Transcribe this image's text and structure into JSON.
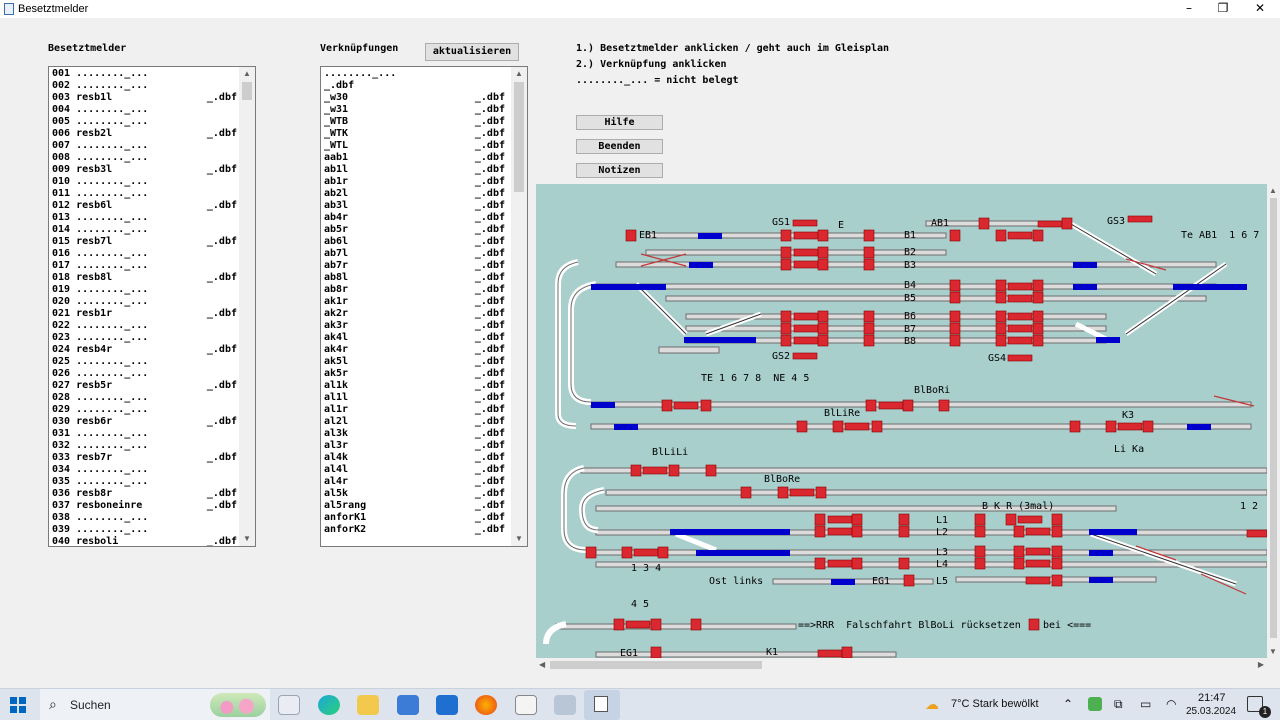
{
  "window": {
    "title": "Besetztmelder",
    "minimize": "–",
    "maximize": "❐",
    "close": "✕"
  },
  "left_panel": {
    "header": "Besetztmelder",
    "rows": [
      {
        "t": "001 ........_...",
        "e": ""
      },
      {
        "t": "002 ........_...",
        "e": ""
      },
      {
        "t": "003 resb1l",
        "e": "_.dbf"
      },
      {
        "t": "004 ........_...",
        "e": ""
      },
      {
        "t": "005 ........_...",
        "e": ""
      },
      {
        "t": "006 resb2l",
        "e": "_.dbf"
      },
      {
        "t": "007 ........_...",
        "e": ""
      },
      {
        "t": "008 ........_...",
        "e": ""
      },
      {
        "t": "009 resb3l",
        "e": "_.dbf"
      },
      {
        "t": "010 ........_...",
        "e": ""
      },
      {
        "t": "011 ........_...",
        "e": ""
      },
      {
        "t": "012 resb6l",
        "e": "_.dbf"
      },
      {
        "t": "013 ........_...",
        "e": ""
      },
      {
        "t": "014 ........_...",
        "e": ""
      },
      {
        "t": "015 resb7l",
        "e": "_.dbf"
      },
      {
        "t": "016 ........_...",
        "e": ""
      },
      {
        "t": "017 ........_...",
        "e": ""
      },
      {
        "t": "018 resb8l",
        "e": "_.dbf"
      },
      {
        "t": "019 ........_...",
        "e": ""
      },
      {
        "t": "020 ........_...",
        "e": ""
      },
      {
        "t": "021 resb1r",
        "e": "_.dbf"
      },
      {
        "t": "022 ........_...",
        "e": ""
      },
      {
        "t": "023 ........_...",
        "e": ""
      },
      {
        "t": "024 resb4r",
        "e": "_.dbf"
      },
      {
        "t": "025 ........_...",
        "e": ""
      },
      {
        "t": "026 ........_...",
        "e": ""
      },
      {
        "t": "027 resb5r",
        "e": "_.dbf"
      },
      {
        "t": "028 ........_...",
        "e": ""
      },
      {
        "t": "029 ........_...",
        "e": ""
      },
      {
        "t": "030 resb6r",
        "e": "_.dbf"
      },
      {
        "t": "031 ........_...",
        "e": ""
      },
      {
        "t": "032 ........_...",
        "e": ""
      },
      {
        "t": "033 resb7r",
        "e": "_.dbf"
      },
      {
        "t": "034 ........_...",
        "e": ""
      },
      {
        "t": "035 ........_...",
        "e": ""
      },
      {
        "t": "036 resb8r",
        "e": "_.dbf"
      },
      {
        "t": "037 resboneinre",
        "e": "_.dbf"
      },
      {
        "t": "038 ........_...",
        "e": ""
      },
      {
        "t": "039 ........_...",
        "e": ""
      },
      {
        "t": "040 resboli",
        "e": "_.dbf"
      }
    ]
  },
  "middle_panel": {
    "header": "Verknüpfungen",
    "refresh_button": "aktualisieren",
    "rows": [
      {
        "t": "........_...",
        "e": ""
      },
      {
        "t": "_.dbf",
        "e": ""
      },
      {
        "t": "_w30",
        "e": "_.dbf"
      },
      {
        "t": "_w31",
        "e": "_.dbf"
      },
      {
        "t": "_WTB",
        "e": "_.dbf"
      },
      {
        "t": "_WTK",
        "e": "_.dbf"
      },
      {
        "t": "_WTL",
        "e": "_.dbf"
      },
      {
        "t": "aab1",
        "e": "_.dbf"
      },
      {
        "t": "ab1l",
        "e": "_.dbf"
      },
      {
        "t": "ab1r",
        "e": "_.dbf"
      },
      {
        "t": "ab2l",
        "e": "_.dbf"
      },
      {
        "t": "ab3l",
        "e": "_.dbf"
      },
      {
        "t": "ab4r",
        "e": "_.dbf"
      },
      {
        "t": "ab5r",
        "e": "_.dbf"
      },
      {
        "t": "ab6l",
        "e": "_.dbf"
      },
      {
        "t": "ab7l",
        "e": "_.dbf"
      },
      {
        "t": "ab7r",
        "e": "_.dbf"
      },
      {
        "t": "ab8l",
        "e": "_.dbf"
      },
      {
        "t": "ab8r",
        "e": "_.dbf"
      },
      {
        "t": "ak1r",
        "e": "_.dbf"
      },
      {
        "t": "ak2r",
        "e": "_.dbf"
      },
      {
        "t": "ak3r",
        "e": "_.dbf"
      },
      {
        "t": "ak4l",
        "e": "_.dbf"
      },
      {
        "t": "ak4r",
        "e": "_.dbf"
      },
      {
        "t": "ak5l",
        "e": "_.dbf"
      },
      {
        "t": "ak5r",
        "e": "_.dbf"
      },
      {
        "t": "al1k",
        "e": "_.dbf"
      },
      {
        "t": "al1l",
        "e": "_.dbf"
      },
      {
        "t": "al1r",
        "e": "_.dbf"
      },
      {
        "t": "al2l",
        "e": "_.dbf"
      },
      {
        "t": "al3k",
        "e": "_.dbf"
      },
      {
        "t": "al3r",
        "e": "_.dbf"
      },
      {
        "t": "al4k",
        "e": "_.dbf"
      },
      {
        "t": "al4l",
        "e": "_.dbf"
      },
      {
        "t": "al4r",
        "e": "_.dbf"
      },
      {
        "t": "al5k",
        "e": "_.dbf"
      },
      {
        "t": "al5rang",
        "e": "_.dbf"
      },
      {
        "t": "anforK1",
        "e": "_.dbf"
      },
      {
        "t": "anforK2",
        "e": "_.dbf"
      }
    ]
  },
  "instructions": [
    "1.) Besetztmelder anklicken / geht auch im Gleisplan",
    "2.) Verknüpfung anklicken",
    "........_... = nicht belegt"
  ],
  "buttons": {
    "help": "Hilfe",
    "quit": "Beenden",
    "notes": "Notizen"
  },
  "track_plan": {
    "labels": {
      "eb1": "EB1",
      "gs1": "GS1",
      "e": "E",
      "ab1": "AB1",
      "gs3": "GS3",
      "teab1": "Te AB1  1 6 7",
      "b1": "B1",
      "b2": "B2",
      "b3": "B3",
      "b4": "B4",
      "b5": "B5",
      "b6": "B6",
      "b7": "B7",
      "b8": "B8",
      "gs2": "GS2",
      "gs4": "GS4",
      "te": "TE 1 6 7 8  NE 4 5",
      "blbori": "BlBoRi",
      "bllire": "BlLiRe",
      "k3": "K3",
      "lika": "Li Ka",
      "bllili": "BlLiLi",
      "blbore": "BlBoRe",
      "bkr": "B K R (3mal)",
      "n12": "1 2",
      "l1": "L1",
      "l2": "L2",
      "l3": "L3",
      "l4": "L4",
      "l5": "L5",
      "n134": "1 3 4",
      "ostlinks": "Ost links",
      "eg1a": "EG1",
      "n45": "4 5",
      "falsch": "==>RRR  Falschfahrt BlBoLi rücksetzen",
      "bei": "bei <===",
      "eg1b": "EG1",
      "k1": "K1"
    },
    "colors": {
      "background": "#a9cfcd",
      "occupied": "#d9282f",
      "reserved": "#0000cc",
      "track": "#6d6d6d"
    }
  },
  "taskbar": {
    "search": "Suchen",
    "weather": "7°C  Stark bewölkt",
    "time": "21:47",
    "date": "25.03.2024",
    "notifications": "1"
  }
}
